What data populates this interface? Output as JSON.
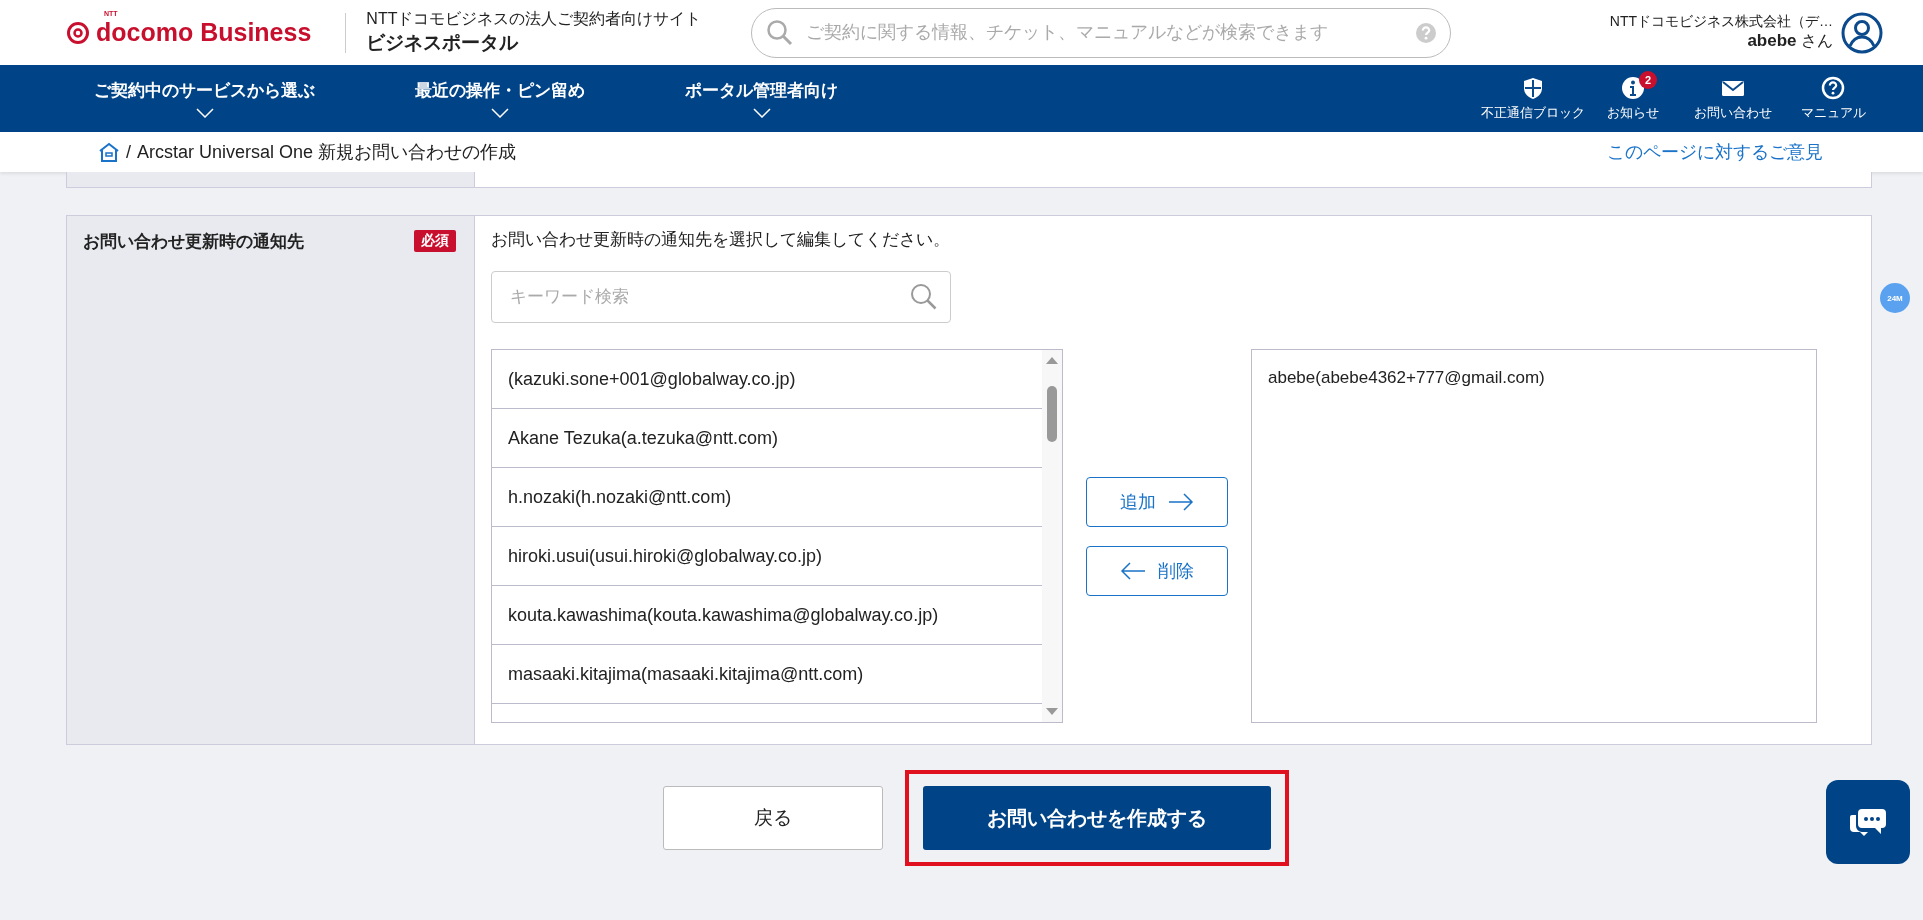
{
  "header": {
    "logo_mark": "NTT",
    "logo": "docomo Business",
    "site_caption": "NTTドコモビジネスの法人ご契約者向けサイト",
    "site_title": "ビジネスポータル",
    "search": {
      "placeholder": "ご契約に関する情報、チケット、マニュアルなどが検索できます"
    },
    "company": "NTTドコモビジネス株式会社（デ…",
    "user_name": "abebe",
    "honorific": "さん"
  },
  "nav": {
    "menus": [
      {
        "label": "ご契約中のサービスから選ぶ"
      },
      {
        "label": "最近の操作・ピン留め"
      },
      {
        "label": "ポータル管理者向け"
      }
    ],
    "tools": [
      {
        "label": "不正通信ブロック",
        "kind": "shield"
      },
      {
        "label": "お知らせ",
        "kind": "info",
        "badge": "2"
      },
      {
        "label": "お問い合わせ",
        "kind": "mail"
      },
      {
        "label": "マニュアル",
        "kind": "help"
      }
    ]
  },
  "breadcrumb": {
    "separator": "/",
    "page": "Arcstar Universal One 新規お問い合わせの作成",
    "feedback_link": "このページに対するご意見"
  },
  "form_row": {
    "label": "お問い合わせ更新時の通知先",
    "required_badge": "必須",
    "instruction": "お問い合わせ更新時の通知先を選択して編集してください。",
    "keyword_search": {
      "placeholder": "キーワード検索"
    },
    "candidates": [
      "(kazuki.sone+001@globalway.co.jp)",
      "Akane Tezuka(a.tezuka@ntt.com)",
      "h.nozaki(h.nozaki@ntt.com)",
      "hiroki.usui(usui.hiroki@globalway.co.jp)",
      "kouta.kawashima(kouta.kawashima@globalway.co.jp)",
      "masaaki.kitajima(masaaki.kitajima@ntt.com)"
    ],
    "add_button": "追加",
    "remove_button": "削除",
    "selected": [
      "abebe(abebe4362+777@gmail.com)"
    ]
  },
  "side_badge": "24M",
  "actions": {
    "back": "戻る",
    "create": "お問い合わせを作成する"
  }
}
